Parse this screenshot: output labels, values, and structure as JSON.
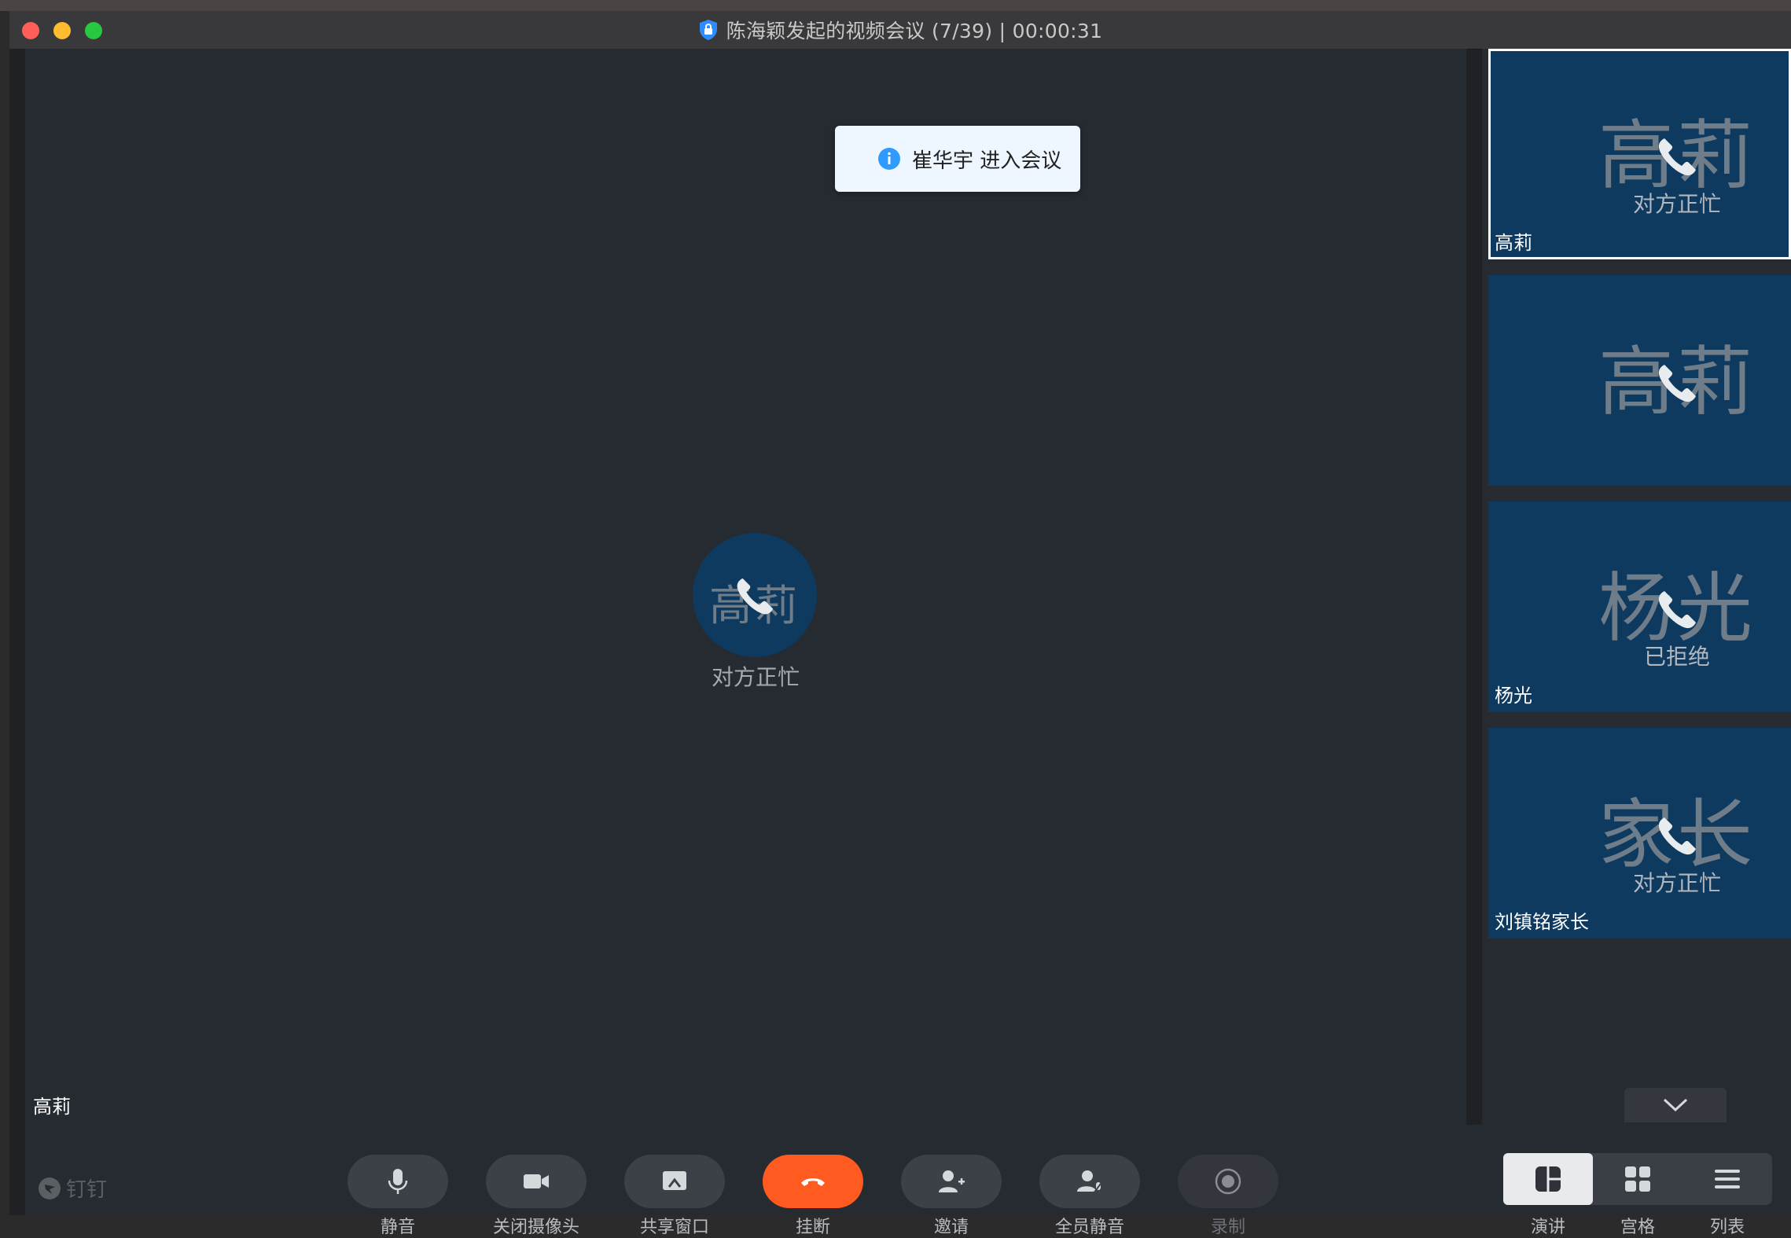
{
  "window": {
    "title": "陈海颖发起的视频会议 (7/39) | 00:00:31"
  },
  "toast": {
    "message": "崔华宇 进入会议"
  },
  "stage": {
    "avatar_text": "高莉",
    "status": "对方正忙",
    "name": "高莉"
  },
  "sidebar": {
    "tiles": [
      {
        "avatar_text": "高莉",
        "status": "对方正忙",
        "name": "高莉",
        "active": true
      },
      {
        "avatar_text": "高莉",
        "status": "",
        "name": "",
        "active": false
      },
      {
        "avatar_text": "杨光",
        "status": "已拒绝",
        "name": "杨光",
        "active": false
      },
      {
        "avatar_text": "家长",
        "status": "对方正忙",
        "name": "刘镇铭家长",
        "active": false
      }
    ]
  },
  "toolbar": {
    "logo": "钉钉",
    "buttons": [
      {
        "label": "静音",
        "icon": "microphone-icon"
      },
      {
        "label": "关闭摄像头",
        "icon": "camera-icon"
      },
      {
        "label": "共享窗口",
        "icon": "share-screen-icon"
      },
      {
        "label": "挂断",
        "icon": "hangup-icon"
      },
      {
        "label": "邀请",
        "icon": "add-user-icon"
      },
      {
        "label": "全员静音",
        "icon": "mute-all-icon"
      },
      {
        "label": "录制",
        "icon": "record-icon"
      }
    ],
    "layouts": [
      {
        "label": "演讲",
        "icon": "speaker-layout-icon",
        "selected": true
      },
      {
        "label": "宫格",
        "icon": "grid-layout-icon",
        "selected": false
      },
      {
        "label": "列表",
        "icon": "list-layout-icon",
        "selected": false
      }
    ]
  },
  "colors": {
    "accent_hangup": "#ff5a1f",
    "tile_bg": "#0d3a5e",
    "stage_bg": "#262a31"
  }
}
